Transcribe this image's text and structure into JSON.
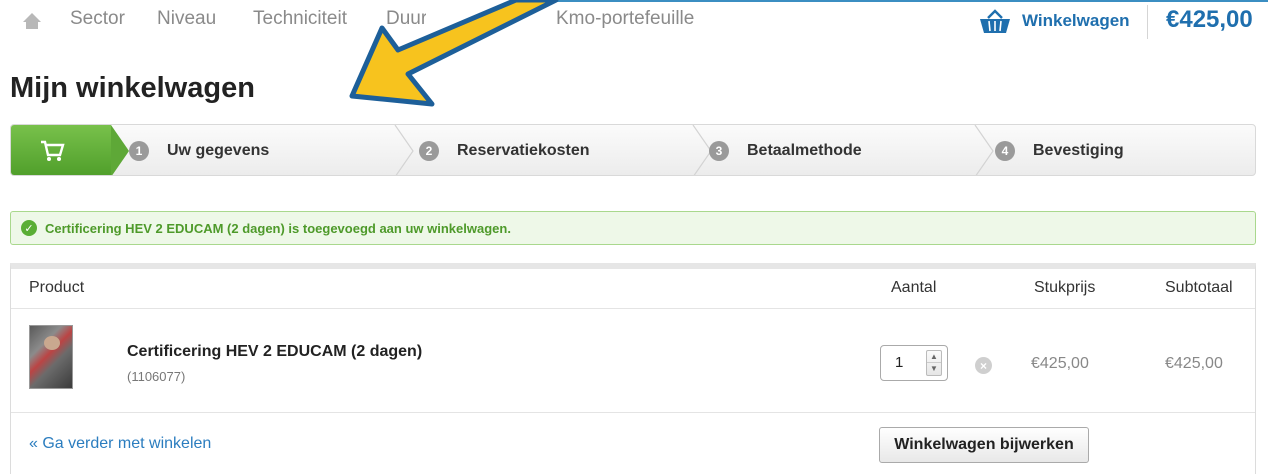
{
  "nav": {
    "items": [
      "Sector",
      "Niveau",
      "Techniciteit",
      "Duur",
      "Kmo-portefeuille"
    ],
    "cart_label": "Winkelwagen",
    "cart_total": "€425,00"
  },
  "page_title": "Mijn winkelwagen",
  "steps": [
    {
      "num": "1",
      "label": "Uw gegevens"
    },
    {
      "num": "2",
      "label": "Reservatiekosten"
    },
    {
      "num": "3",
      "label": "Betaalmethode"
    },
    {
      "num": "4",
      "label": "Bevestiging"
    }
  ],
  "alert": "Certificering HEV 2 EDUCAM (2 dagen) is toegevoegd aan uw winkelwagen.",
  "table": {
    "headers": {
      "product": "Product",
      "qty": "Aantal",
      "unit": "Stukprijs",
      "subtotal": "Subtotaal"
    },
    "rows": [
      {
        "name": "Certificering HEV 2 EDUCAM (2 dagen)",
        "sku": "(1106077)",
        "qty": "1",
        "unit": "€425,00",
        "subtotal": "€425,00"
      }
    ]
  },
  "continue_link": "« Ga verder met winkelen",
  "update_button": "Winkelwagen bijwerken",
  "colors": {
    "accent": "#1f6fae",
    "success": "#5aae35",
    "arrow": "#f7c31e",
    "arrow_outline": "#1d5f99"
  }
}
